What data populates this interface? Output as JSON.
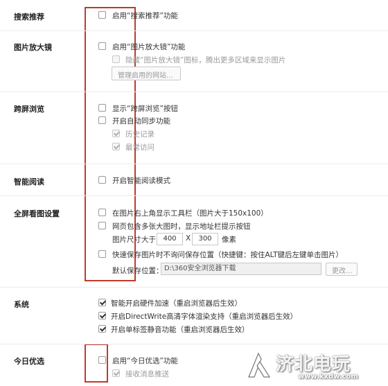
{
  "sections": {
    "search": {
      "title": "搜索推荐",
      "enable": "启用“搜索推荐”功能"
    },
    "magnifier": {
      "title": "图片放大镜",
      "enable": "启用“图片放大镜”功能",
      "hide_icon": "隐藏“图片放大镜”图标，腾出更多区域来显示图片",
      "manage_btn": "管理启用的网站..."
    },
    "splitscreen": {
      "title": "跨屏浏览",
      "show_btn": "显示“跨屏浏览”按钮",
      "auto_sync": "开启自动同步功能",
      "history": "历史记录",
      "recent": "最常访问"
    },
    "reader": {
      "title": "智能阅读",
      "enable": "开启智能阅读模式"
    },
    "fullscreen": {
      "title": "全屏看图设置",
      "toolbar": "在图片右上角显示工具栏（图片大于150x100）",
      "multi": "网页包含多张大图时，显示地址栏提示按钮",
      "size_label": "图片尺寸大于",
      "width": "400",
      "x": "X",
      "height": "300",
      "unit": "像素",
      "quick_save": "快速保存图片时不询问保存位置（快捷键：按住ALT键后左键单击图片）",
      "default_path_label": "默认保存位置：",
      "default_path": "D:\\360安全浏览器下载",
      "change_btn": "更改..."
    },
    "system": {
      "title": "系统",
      "hw_accel": "智能开启硬件加速（重启浏览器后生效）",
      "directwrite": "开启DirectWrite高清字体渲染支持（重启浏览器后生效）",
      "mute": "开启单标签静音功能（重启浏览器后生效）"
    },
    "today": {
      "title": "今日优选",
      "enable": "启用“今日优选”功能",
      "push": "接收消息推送"
    }
  },
  "watermark": {
    "text": "济北电玩",
    "url": "www.kxdw.com"
  },
  "colors": {
    "highlight_box": "#c0392b"
  }
}
